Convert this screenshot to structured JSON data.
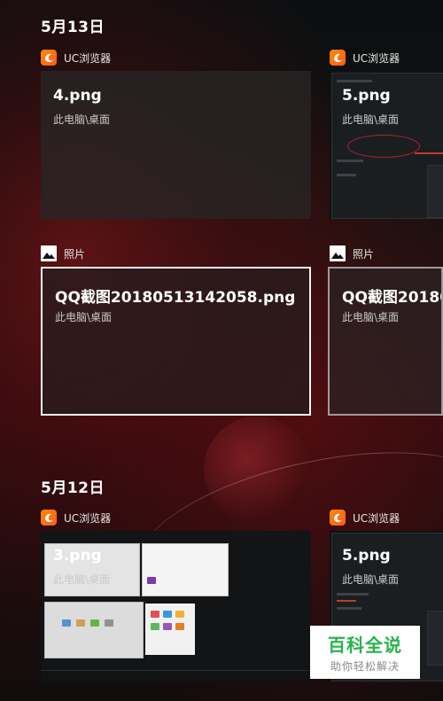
{
  "groups": [
    {
      "date": "5月13日",
      "items": [
        {
          "app": "UC浏览器",
          "app_icon": "uc-browser-icon",
          "title": "4.png",
          "path": "此电脑\\桌面"
        },
        {
          "app": "UC浏览器",
          "app_icon": "uc-browser-icon",
          "title": "5.png",
          "path": "此电脑\\桌面"
        },
        {
          "app": "照片",
          "app_icon": "photos-icon",
          "title": "QQ截图20180513142058.png",
          "path": "此电脑\\桌面"
        },
        {
          "app": "照片",
          "app_icon": "photos-icon",
          "title": "QQ截图20180",
          "path": "此电脑\\桌面"
        }
      ]
    },
    {
      "date": "5月12日",
      "items": [
        {
          "app": "UC浏览器",
          "app_icon": "uc-browser-icon",
          "title": "3.png",
          "path": "此电脑\\桌面"
        },
        {
          "app": "UC浏览器",
          "app_icon": "uc-browser-icon",
          "title": "5.png",
          "path": "此电脑\\桌面"
        }
      ]
    }
  ],
  "watermark": {
    "title": "百科全说",
    "subtitle": "助你轻松解决"
  },
  "colors": {
    "uc_orange": "#ff7a00",
    "watermark_green": "#27b34a",
    "selection_border": "#f2f2f2"
  }
}
